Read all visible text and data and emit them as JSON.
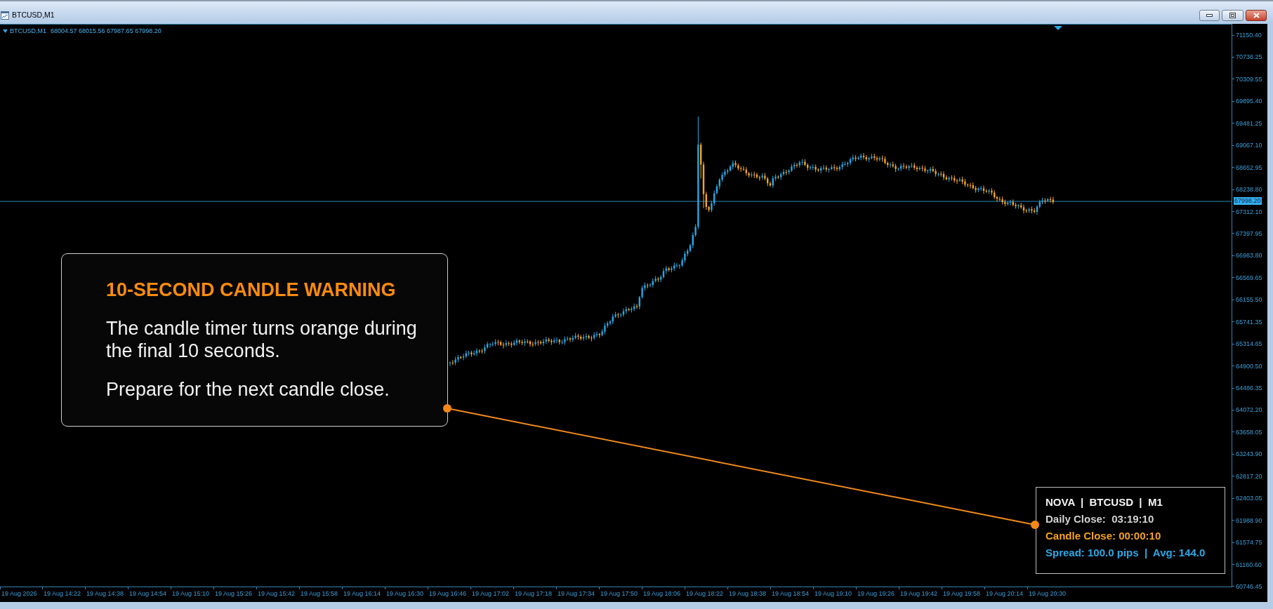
{
  "window": {
    "title": "BTCUSD,M1"
  },
  "chart_header": {
    "symbol": "BTCUSD,M1",
    "values": "68004.57 68015.56 67987.65 67998.20"
  },
  "price_axis": {
    "labels": [
      "71150.40",
      "70736.25",
      "70309.55",
      "69895.40",
      "69481.25",
      "69067.10",
      "68652.95",
      "68238.80",
      "67312.10",
      "67397.95",
      "66983.80",
      "66569.65",
      "66155.50",
      "65741.35",
      "65314.65",
      "64900.50",
      "64486.35",
      "64072.20",
      "63658.05",
      "63243.90",
      "62817.20",
      "62403.05",
      "61988.90",
      "61574.75",
      "61160.60",
      "60746.45"
    ],
    "current_price": "67998.20"
  },
  "time_axis": {
    "labels": [
      "19 Aug 2026",
      "19 Aug 14:22",
      "19 Aug 14:38",
      "19 Aug 14:54",
      "19 Aug 15:10",
      "19 Aug 15:26",
      "19 Aug 15:42",
      "19 Aug 15:58",
      "19 Aug 16:14",
      "19 Aug 16:30",
      "19 Aug 16:46",
      "19 Aug 17:02",
      "19 Aug 17:18",
      "19 Aug 17:34",
      "19 Aug 17:50",
      "19 Aug 18:06",
      "19 Aug 18:22",
      "19 Aug 18:38",
      "19 Aug 18:54",
      "19 Aug 19:10",
      "19 Aug 19:26",
      "19 Aug 19:42",
      "19 Aug 19:58",
      "19 Aug 20:14",
      "19 Aug 20:30"
    ]
  },
  "callout": {
    "title": "10-SECOND CANDLE WARNING",
    "paragraphs": [
      "The candle timer turns orange during the final 10 seconds.",
      "Prepare for the next candle close."
    ]
  },
  "info_panel": {
    "lines": [
      {
        "kind": "heading",
        "text": "NOVA  |  BTCUSD  |  M1"
      },
      {
        "kind": "timer",
        "text": "Daily Close:  03:19:10"
      },
      {
        "kind": "warning",
        "text": "Candle Close: 00:00:10"
      },
      {
        "kind": "spread",
        "text": "Spread: 100.0 pips  |  Avg: 144.0"
      }
    ]
  }
}
